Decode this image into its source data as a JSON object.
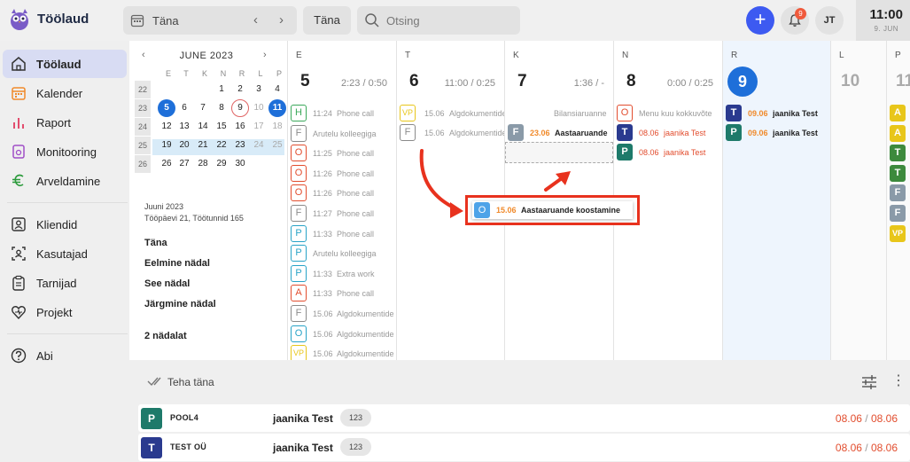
{
  "app": {
    "title": "Töölaud"
  },
  "topbar": {
    "date_label": "Täna",
    "today_button": "Täna",
    "search_placeholder": "Otsing",
    "add_label": "+",
    "notifications_count": "9",
    "avatar_initials": "JT",
    "clock_time": "11:00",
    "clock_date": "9. JUN"
  },
  "sidebar": {
    "items": [
      {
        "label": "Töölaud",
        "icon": "home-icon",
        "active": true
      },
      {
        "label": "Kalender",
        "icon": "calendar-icon"
      },
      {
        "label": "Raport",
        "icon": "bar-chart-icon"
      },
      {
        "label": "Monitooring",
        "icon": "monitor-icon"
      },
      {
        "label": "Arveldamine",
        "icon": "euro-icon"
      },
      {
        "label": "Kliendid",
        "icon": "client-icon"
      },
      {
        "label": "Kasutajad",
        "icon": "user-scan-icon"
      },
      {
        "label": "Tarnijad",
        "icon": "clipboard-icon"
      },
      {
        "label": "Projekt",
        "icon": "heart-project-icon"
      },
      {
        "label": "Abi",
        "icon": "help-icon"
      }
    ]
  },
  "minical": {
    "month": "JUNE 2023",
    "dow": [
      "E",
      "T",
      "K",
      "N",
      "R",
      "L",
      "P"
    ],
    "weeks": [
      {
        "wk": "22",
        "days": [
          "",
          "",
          "",
          "1",
          "2",
          "3",
          "4"
        ]
      },
      {
        "wk": "23",
        "days": [
          "5",
          "6",
          "7",
          "8",
          "9",
          "10",
          "11"
        ]
      },
      {
        "wk": "24",
        "days": [
          "12",
          "13",
          "14",
          "15",
          "16",
          "17",
          "18"
        ]
      },
      {
        "wk": "25",
        "days": [
          "19",
          "20",
          "21",
          "22",
          "23",
          "24",
          "25"
        ]
      },
      {
        "wk": "26",
        "days": [
          "26",
          "27",
          "28",
          "29",
          "30",
          "",
          ""
        ]
      }
    ],
    "info_month": "Juuni 2023",
    "info_stats": "Tööpäevi 21, Töötunnid 165",
    "links": [
      "Täna",
      "Eelmine nädal",
      "See nädal",
      "Järgmine nädal",
      "2 nädalat"
    ]
  },
  "days": [
    {
      "dow": "E",
      "num": "5",
      "stat": "2:23 / 0:50"
    },
    {
      "dow": "T",
      "num": "6",
      "stat": "11:00 / 0:25"
    },
    {
      "dow": "K",
      "num": "7",
      "stat": "1:36 / -"
    },
    {
      "dow": "N",
      "num": "8",
      "stat": "0:00 / 0:25"
    },
    {
      "dow": "R",
      "num": "9",
      "stat": ""
    },
    {
      "dow": "L",
      "num": "10",
      "stat": ""
    },
    {
      "dow": "P",
      "num": "11",
      "stat": ""
    }
  ],
  "events_mon": [
    {
      "tag": "H",
      "color": "#3aa85a",
      "time": "11:24",
      "text": "Phone call"
    },
    {
      "tag": "F",
      "color": "#8a8a8a",
      "time": "",
      "text": "Arutelu kolleegiga"
    },
    {
      "tag": "O",
      "color": "#e24d2e",
      "time": "11:25",
      "text": "Phone call"
    },
    {
      "tag": "O",
      "color": "#e24d2e",
      "time": "11:26",
      "text": "Phone call"
    },
    {
      "tag": "O",
      "color": "#e24d2e",
      "time": "11:26",
      "text": "Phone call"
    },
    {
      "tag": "F",
      "color": "#8a8a8a",
      "time": "11:27",
      "text": "Phone call"
    },
    {
      "tag": "P",
      "color": "#28a3c7",
      "time": "11:33",
      "text": "Phone call"
    },
    {
      "tag": "P",
      "color": "#28a3c7",
      "time": "",
      "text": "Arutelu kolleegiga"
    },
    {
      "tag": "P",
      "color": "#28a3c7",
      "time": "11:33",
      "text": "Extra work"
    },
    {
      "tag": "A",
      "color": "#e24d2e",
      "time": "11:33",
      "text": "Phone call"
    },
    {
      "tag": "F",
      "color": "#8a8a8a",
      "time": "15.06",
      "text": "Algdokumentide"
    },
    {
      "tag": "O",
      "color": "#28a3c7",
      "time": "15.06",
      "text": "Algdokumentide"
    },
    {
      "tag": "VP",
      "color": "#e8c61a",
      "time": "15.06",
      "text": "Algdokumentide"
    }
  ],
  "events_tue": [
    {
      "tag": "VP",
      "color": "#e8c61a",
      "time": "15.06",
      "text": "Algdokumentide vastuvõtt"
    },
    {
      "tag": "F",
      "color": "#8a8a8a",
      "time": "15.06",
      "text": "Algdokumentide"
    }
  ],
  "events_wed": [
    {
      "tag": "",
      "text": "Bilansiaruanne"
    },
    {
      "tag": "F",
      "color": "#8a9aa8",
      "time": "23.06",
      "text": "Aastaaruande"
    }
  ],
  "events_thu": [
    {
      "tag": "O",
      "color": "#e24d2e",
      "time": "",
      "text": "Menu kuu kokkuvõte"
    },
    {
      "tag": "T",
      "color": "#2a3a8f",
      "time": "08.06",
      "text": "jaanika Test"
    },
    {
      "tag": "P",
      "color": "#1e7a6a",
      "time": "08.06",
      "text": "jaanika Test"
    }
  ],
  "events_fri": [
    {
      "tag": "T",
      "color": "#2a3a8f",
      "time": "09.06",
      "text": "jaanika Test"
    },
    {
      "tag": "P",
      "color": "#1e7a6a",
      "time": "09.06",
      "text": "jaanika Test"
    }
  ],
  "events_sun": [
    {
      "tag": "A",
      "color": "#e8c61a"
    },
    {
      "tag": "A",
      "color": "#e8c61a"
    },
    {
      "tag": "T",
      "color": "#3d8a3d"
    },
    {
      "tag": "T",
      "color": "#3d8a3d"
    },
    {
      "tag": "F",
      "color": "#8a9aa8"
    },
    {
      "tag": "F",
      "color": "#8a9aa8"
    },
    {
      "tag": "VP",
      "color": "#e8c61a"
    }
  ],
  "drag_event": {
    "tag": "O",
    "time": "15.06",
    "text": "Aastaaruande koostamine"
  },
  "todo": {
    "title": "Teha täna",
    "rows": [
      {
        "tag": "P",
        "color": "#1e7a6a",
        "name": "POOL4",
        "user": "jaanika Test",
        "count": "123",
        "start": "08.06",
        "end": "08.06"
      },
      {
        "tag": "T",
        "color": "#2a3a8f",
        "name": "TEST OÜ",
        "user": "jaanika Test",
        "count": "123",
        "start": "08.06",
        "end": "08.06"
      }
    ]
  }
}
